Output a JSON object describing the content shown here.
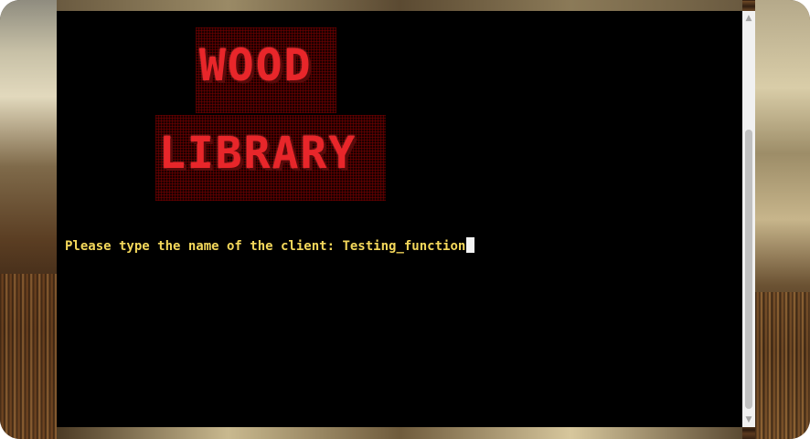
{
  "terminal": {
    "logo_line_1": "WOOD",
    "logo_line_2": "LIBRARY",
    "prompt": "Please type the name of the client: ",
    "input_value": "Testing_function"
  },
  "scrollbar": {
    "up_icon": "triangle-up-icon",
    "down_icon": "triangle-down-icon",
    "up_glyph": "▲",
    "down_glyph": "▼"
  },
  "colors": {
    "terminal_bg": "#000000",
    "prompt_text": "#f4d85b",
    "logo_red": "#e8262a",
    "cursor": "#f4f4f4"
  }
}
